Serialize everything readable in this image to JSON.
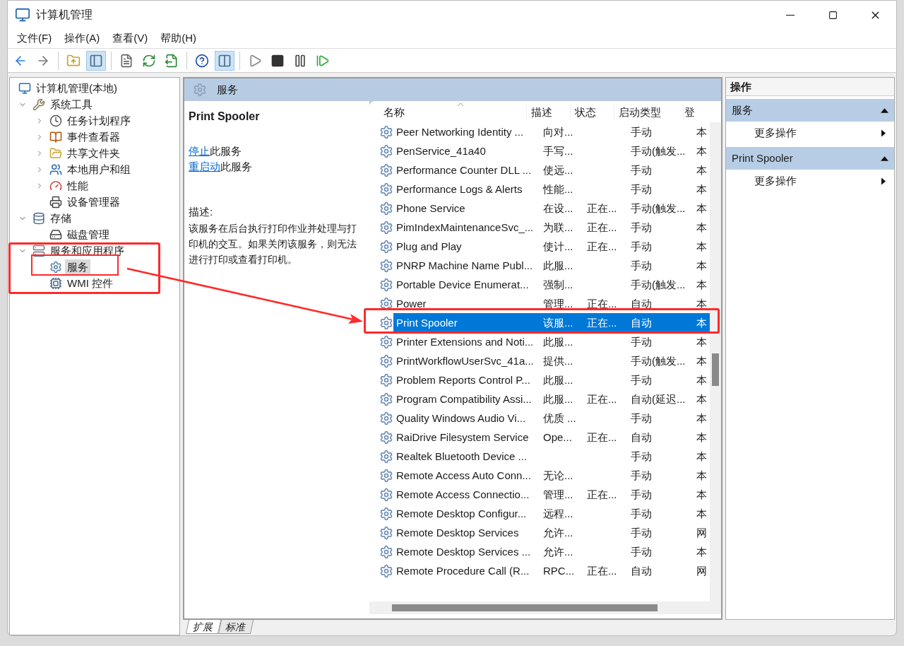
{
  "window": {
    "title": "计算机管理"
  },
  "menu": [
    "文件(F)",
    "操作(A)",
    "查看(V)",
    "帮助(H)"
  ],
  "tree": [
    {
      "label": "计算机管理(本地)",
      "selected": false,
      "children": [
        {
          "label": "系统工具",
          "selected": false,
          "expanded": true,
          "children": [
            {
              "label": "任务计划程序",
              "selected": false,
              "expanded": false
            },
            {
              "label": "事件查看器",
              "selected": false,
              "expanded": false
            },
            {
              "label": "共享文件夹",
              "selected": false,
              "expanded": false
            },
            {
              "label": "本地用户和组",
              "selected": false,
              "expanded": false
            },
            {
              "label": "性能",
              "selected": false,
              "expanded": false
            },
            {
              "label": "设备管理器",
              "selected": false
            }
          ]
        },
        {
          "label": "存储",
          "selected": false,
          "expanded": true,
          "children": [
            {
              "label": "磁盘管理",
              "selected": false
            }
          ]
        },
        {
          "label": "服务和应用程序",
          "selected": false,
          "expanded": true,
          "children": [
            {
              "label": "服务",
              "selected": true
            },
            {
              "label": "WMI 控件",
              "selected": false
            }
          ]
        }
      ]
    }
  ],
  "panel_header": "服务",
  "detail": {
    "title": "Print Spooler",
    "links": [
      {
        "link": "停止",
        "text": "此服务"
      },
      {
        "link": "重启动",
        "text": "此服务"
      }
    ],
    "description_label": "描述:",
    "description": "该服务在后台执行打印作业并处理与打印机的交互。如果关闭该服务，则无法进行打印或查看打印机。"
  },
  "table": {
    "columns": [
      "名称",
      "描述",
      "状态",
      "启动类型",
      "登"
    ],
    "rows": [
      {
        "name": "Peer Networking Identity ...",
        "description": "向对...",
        "status": "",
        "startup": "手动",
        "column_5": "本",
        "selected": false
      },
      {
        "name": "PenService_41a40",
        "description": "手写...",
        "status": "",
        "startup": "手动(触发...",
        "column_5": "本",
        "selected": false
      },
      {
        "name": "Performance Counter DLL ...",
        "description": "使远...",
        "status": "",
        "startup": "手动",
        "column_5": "本",
        "selected": false
      },
      {
        "name": "Performance Logs & Alerts",
        "description": "性能...",
        "status": "",
        "startup": "手动",
        "column_5": "本",
        "selected": false
      },
      {
        "name": "Phone Service",
        "description": "在设...",
        "status": "正在...",
        "startup": "手动(触发...",
        "column_5": "本",
        "selected": false
      },
      {
        "name": "PimIndexMaintenanceSvc_...",
        "description": "为联...",
        "status": "正在...",
        "startup": "手动",
        "column_5": "本",
        "selected": false
      },
      {
        "name": "Plug and Play",
        "description": "使计...",
        "status": "正在...",
        "startup": "手动",
        "column_5": "本",
        "selected": false
      },
      {
        "name": "PNRP Machine Name Publ...",
        "description": "此服...",
        "status": "",
        "startup": "手动",
        "column_5": "本",
        "selected": false
      },
      {
        "name": "Portable Device Enumerat...",
        "description": "强制...",
        "status": "",
        "startup": "手动(触发...",
        "column_5": "本",
        "selected": false
      },
      {
        "name": "Power",
        "description": "管理...",
        "status": "正在...",
        "startup": "自动",
        "column_5": "本",
        "selected": false
      },
      {
        "name": "Print Spooler",
        "description": "该服...",
        "status": "正在...",
        "startup": "自动",
        "column_5": "本",
        "selected": true
      },
      {
        "name": "Printer Extensions and Noti...",
        "description": "此服...",
        "status": "",
        "startup": "手动",
        "column_5": "本",
        "selected": false
      },
      {
        "name": "PrintWorkflowUserSvc_41a...",
        "description": "提供...",
        "status": "",
        "startup": "手动(触发...",
        "column_5": "本",
        "selected": false
      },
      {
        "name": "Problem Reports Control P...",
        "description": "此服...",
        "status": "",
        "startup": "手动",
        "column_5": "本",
        "selected": false
      },
      {
        "name": "Program Compatibility Assi...",
        "description": "此服...",
        "status": "正在...",
        "startup": "自动(延迟...",
        "column_5": "本",
        "selected": false
      },
      {
        "name": "Quality Windows Audio Vi...",
        "description": "优质 ...",
        "status": "",
        "startup": "手动",
        "column_5": "本",
        "selected": false
      },
      {
        "name": "RaiDrive Filesystem Service",
        "description": "Ope...",
        "status": "正在...",
        "startup": "自动",
        "column_5": "本",
        "selected": false
      },
      {
        "name": "Realtek Bluetooth Device ...",
        "description": "",
        "status": "",
        "startup": "手动",
        "column_5": "本",
        "selected": false
      },
      {
        "name": "Remote Access Auto Conn...",
        "description": "无论...",
        "status": "",
        "startup": "手动",
        "column_5": "本",
        "selected": false
      },
      {
        "name": "Remote Access Connectio...",
        "description": "管理...",
        "status": "正在...",
        "startup": "手动",
        "column_5": "本",
        "selected": false
      },
      {
        "name": "Remote Desktop Configur...",
        "description": "远程...",
        "status": "",
        "startup": "手动",
        "column_5": "本",
        "selected": false
      },
      {
        "name": "Remote Desktop Services",
        "description": "允许...",
        "status": "",
        "startup": "手动",
        "column_5": "网",
        "selected": false
      },
      {
        "name": "Remote Desktop Services ...",
        "description": "允许...",
        "status": "",
        "startup": "手动",
        "column_5": "本",
        "selected": false
      },
      {
        "name": "Remote Procedure Call (R...",
        "description": "RPC...",
        "status": "正在...",
        "startup": "自动",
        "column_5": "网",
        "selected": false
      }
    ]
  },
  "view_tabs": [
    {
      "label": "扩展",
      "selected": true
    },
    {
      "label": "标准",
      "selected": false
    }
  ],
  "actions": {
    "title": "操作",
    "sections": [
      {
        "title": "服务",
        "expanded": true,
        "items": [
          "更多操作"
        ]
      },
      {
        "title": "Print Spooler",
        "expanded": true,
        "items": [
          "更多操作"
        ]
      }
    ]
  }
}
